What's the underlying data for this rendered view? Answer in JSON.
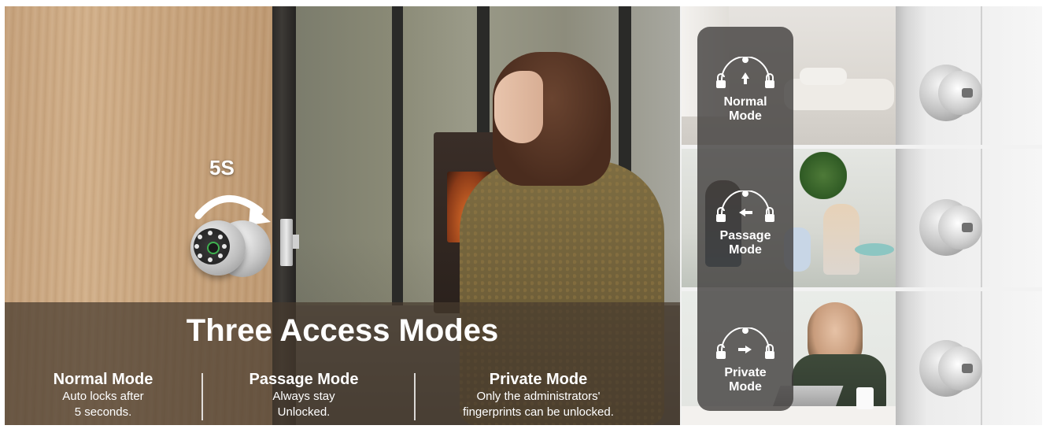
{
  "hero": {
    "timer_label": "5S",
    "band_title": "Three Access Modes",
    "modes": [
      {
        "title": "Normal Mode",
        "line1": "Auto locks after",
        "line2": "5 seconds."
      },
      {
        "title": "Passage Mode",
        "line1": "Always stay",
        "line2": "Unlocked."
      },
      {
        "title": "Private Mode",
        "line1": "Only the administrators'",
        "line2": "fingerprints can be unlocked."
      }
    ]
  },
  "panels": [
    {
      "label_line1": "Normal",
      "label_line2": "Mode",
      "arrow_icon": "up-arrow-icon"
    },
    {
      "label_line1": "Passage",
      "label_line2": "Mode",
      "arrow_icon": "left-arrow-icon"
    },
    {
      "label_line1": "Private",
      "label_line2": "Mode",
      "arrow_icon": "right-arrow-icon"
    }
  ],
  "colors": {
    "band_overlay": "#46392e",
    "mode_overlay": "#3c3a38",
    "text": "#ffffff",
    "fingerprint_ring": "#3fb24f"
  }
}
